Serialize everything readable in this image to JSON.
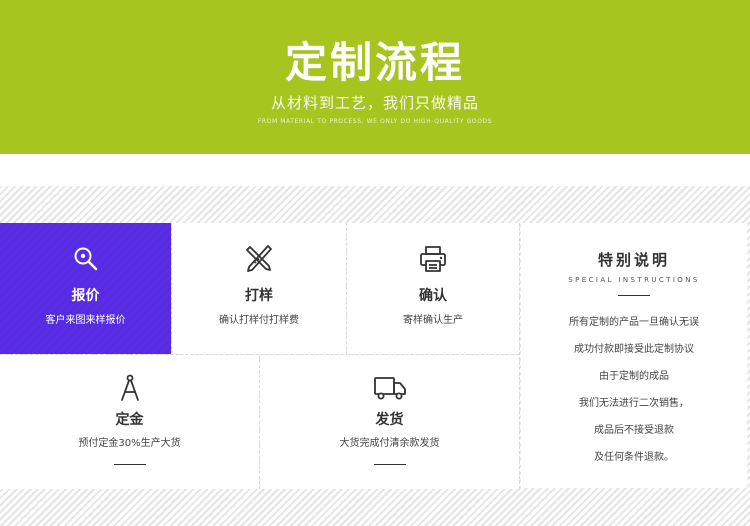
{
  "banner": {
    "title": "定制流程",
    "subtitle": "从材料到工艺，我们只做精品",
    "tagline": "FROM MATERIAL TO PROCESS, WE ONLY DO HIGH-QUALITY GOODS"
  },
  "colors": {
    "banner_green": "#a7c41f",
    "active_purple": "#5b2be6"
  },
  "steps": [
    {
      "name": "报价",
      "desc": "客户来图来样报价",
      "icon": "search-icon",
      "active": true
    },
    {
      "name": "打样",
      "desc": "确认打样付打样费",
      "icon": "pencil-ruler-icon"
    },
    {
      "name": "确认",
      "desc": "寄样确认生产",
      "icon": "printer-icon"
    },
    {
      "name": "定金",
      "desc": "预付定金30%生产大货",
      "icon": "compass-icon"
    },
    {
      "name": "发货",
      "desc": "大货完成付清余款发货",
      "icon": "delivery-truck-icon"
    }
  ],
  "notice": {
    "title": "特别说明",
    "subtitle": "SPECIAL INSTRUCTIONS",
    "lines": [
      "所有定制的产品一旦确认无误",
      "成功付款即接受此定制协议",
      "由于定制的成品",
      "我们无法进行二次销售，",
      "成品后不接受退款",
      "及任何条件退款。"
    ]
  }
}
